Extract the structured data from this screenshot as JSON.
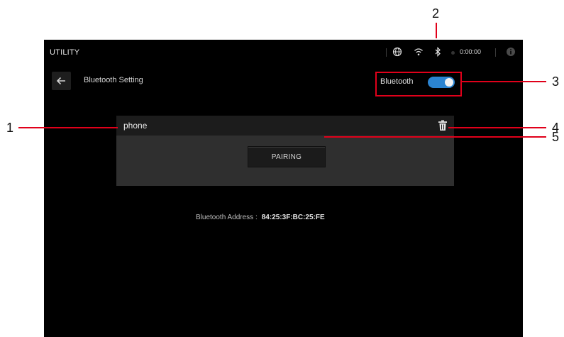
{
  "status_bar": {
    "title": "UTILITY",
    "time": "0:00:00",
    "icons": [
      "globe-icon",
      "wifi-icon",
      "bluetooth-icon",
      "record-dot-icon",
      "info-icon"
    ]
  },
  "header": {
    "page_title": "Bluetooth Setting",
    "back_icon": "back-arrow-icon"
  },
  "bluetooth_toggle": {
    "label": "Bluetooth",
    "state": "on",
    "accent": "#2b84d1"
  },
  "device": {
    "name": "phone",
    "delete_icon": "trash-icon",
    "pair_label": "PAIRING"
  },
  "address": {
    "label": "Bluetooth Address :",
    "value": "84:25:3F:BC:25:FE"
  },
  "callouts": [
    "1",
    "2",
    "3",
    "4",
    "5"
  ],
  "colors": {
    "callout": "#e0001a",
    "background": "#000000",
    "card": "#2f2f2f"
  }
}
